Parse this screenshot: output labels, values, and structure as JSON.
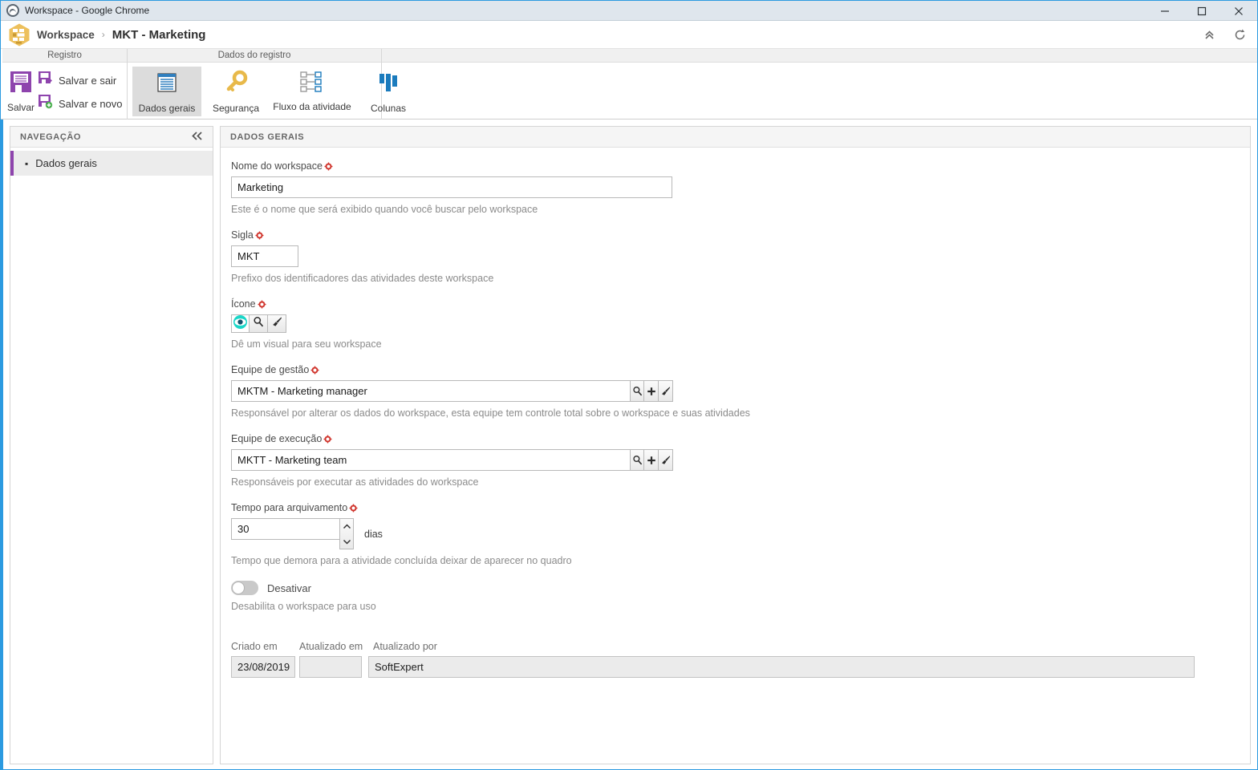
{
  "window": {
    "title": "Workspace - Google Chrome",
    "icon": "chrome-globe-icon",
    "minimize": "—",
    "maximize": "☐",
    "close": "✕"
  },
  "header": {
    "logo_icon": "workspace-hexagon-icon",
    "breadcrumb_root": "Workspace",
    "breadcrumb_separator": "›",
    "breadcrumb_current": "MKT - Marketing",
    "collapse_icon": "chevron-double-up-icon",
    "refresh_icon": "refresh-icon"
  },
  "ribbon": {
    "groups": [
      {
        "title": "Registro",
        "big_button": {
          "label": "Salvar",
          "icon": "floppy-disk-icon"
        },
        "small_buttons": [
          {
            "label": "Salvar e sair",
            "icon": "save-and-exit-icon"
          },
          {
            "label": "Salvar e novo",
            "icon": "save-and-new-icon"
          }
        ]
      },
      {
        "title": "Dados do registro",
        "tabs": [
          {
            "label": "Dados gerais",
            "icon": "document-lines-icon",
            "selected": true
          },
          {
            "label": "Segurança",
            "icon": "key-icon",
            "selected": false
          },
          {
            "label": "Fluxo da atividade",
            "icon": "workflow-icon",
            "selected": false
          },
          {
            "label": "Colunas",
            "icon": "columns-icon",
            "selected": false
          }
        ]
      }
    ]
  },
  "navigation": {
    "title": "NAVEGAÇÃO",
    "collapse_icon": "chevron-double-left-icon",
    "items": [
      {
        "label": "Dados gerais",
        "active": true
      }
    ]
  },
  "form": {
    "title": "DADOS GERAIS",
    "required_marker_icon": "required-field-icon",
    "fields": {
      "workspace_name": {
        "label": "Nome do workspace",
        "value": "Marketing",
        "hint": "Este é o nome que será exibido quando você buscar pelo workspace"
      },
      "acronym": {
        "label": "Sigla",
        "value": "MKT",
        "hint": "Prefixo dos identificadores das atividades deste workspace"
      },
      "icon": {
        "label": "Ícone",
        "hint": "Dê um visual para seu workspace",
        "buttons": [
          {
            "icon": "eye-icon",
            "selected": true
          },
          {
            "icon": "magnifier-icon",
            "selected": false
          },
          {
            "icon": "brush-icon",
            "selected": false
          }
        ]
      },
      "management_team": {
        "label": "Equipe de gestão",
        "value": "MKTM - Marketing manager",
        "hint": "Responsável por alterar os dados do workspace, esta equipe tem controle total sobre o workspace e suas atividades",
        "buttons": [
          {
            "icon": "magnifier-icon"
          },
          {
            "icon": "plus-icon"
          },
          {
            "icon": "eraser-icon"
          }
        ]
      },
      "execution_team": {
        "label": "Equipe de execução",
        "value": "MKTT - Marketing team",
        "hint": "Responsáveis por executar as atividades do workspace",
        "buttons": [
          {
            "icon": "magnifier-icon"
          },
          {
            "icon": "plus-icon"
          },
          {
            "icon": "eraser-icon"
          }
        ]
      },
      "archive_time": {
        "label": "Tempo para arquivamento",
        "value": "30",
        "unit": "dias",
        "hint": "Tempo que demora para a atividade concluída deixar de aparecer no quadro",
        "spinner_up_icon": "chevron-up-icon",
        "spinner_down_icon": "chevron-down-icon"
      },
      "disable_toggle": {
        "label": "Desativar",
        "state": "off",
        "hint": "Desabilita o workspace para uso"
      }
    },
    "audit": {
      "created_at_label": "Criado em",
      "created_at_value": "23/08/2019",
      "updated_at_label": "Atualizado em",
      "updated_at_value": "",
      "updated_by_label": "Atualizado por",
      "updated_by_value": "SoftExpert"
    }
  },
  "colors": {
    "accent_blue": "#2b9ae0",
    "purple": "#8e44ad",
    "gold": "#e8b94a",
    "cyan": "#1ad6c8",
    "required_red": "#d0342c",
    "tab_blue": "#1b7bbd"
  }
}
